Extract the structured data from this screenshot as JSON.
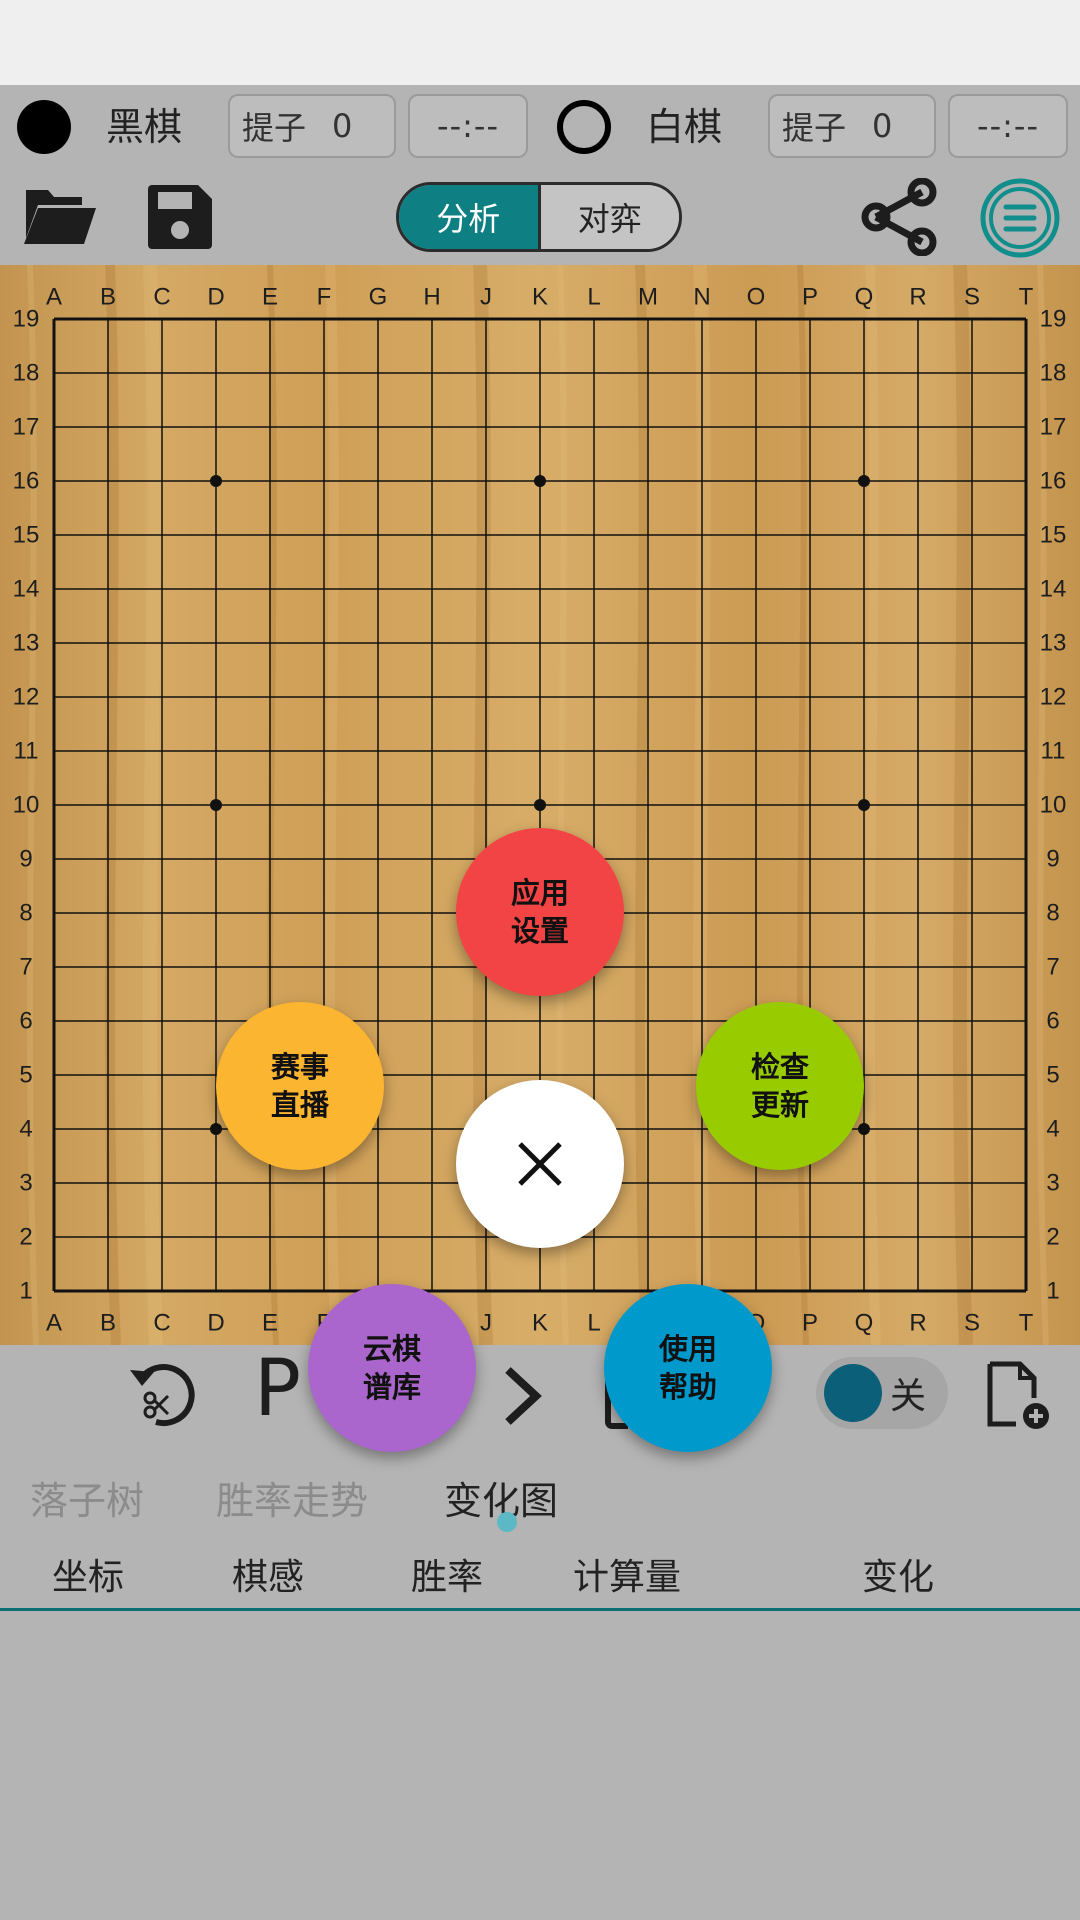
{
  "players": {
    "black": {
      "name": "黑棋",
      "captures_label": "提子",
      "captures": "0",
      "time": "--:--"
    },
    "white": {
      "name": "白棋",
      "captures_label": "提子",
      "captures": "0",
      "time": "--:--"
    }
  },
  "toolbar": {
    "mode_tabs": [
      "分析",
      "对弈"
    ],
    "active_mode": "分析"
  },
  "board": {
    "columns": [
      "A",
      "B",
      "C",
      "D",
      "E",
      "F",
      "G",
      "H",
      "J",
      "K",
      "L",
      "M",
      "N",
      "O",
      "P",
      "Q",
      "R",
      "S",
      "T"
    ],
    "rows": [
      "19",
      "18",
      "17",
      "16",
      "15",
      "14",
      "13",
      "12",
      "11",
      "10",
      "9",
      "8",
      "7",
      "6",
      "5",
      "4",
      "3",
      "2",
      "1"
    ],
    "size": 19
  },
  "fab_menu": {
    "settings": {
      "line1": "应用",
      "line2": "设置",
      "color": "#f24444"
    },
    "live": {
      "line1": "赛事",
      "line2": "直播",
      "color": "#fbb530"
    },
    "update": {
      "line1": "检查",
      "line2": "更新",
      "color": "#99cc00"
    },
    "cloud": {
      "line1": "云棋",
      "line2": "谱库",
      "color": "#aa66cc"
    },
    "help": {
      "line1": "使用",
      "line2": "帮助",
      "color": "#0099cc"
    },
    "close_icon": "close-icon"
  },
  "controls": {
    "pass_label": "P",
    "toggle_label": "关",
    "toggle_on": false
  },
  "tabs": {
    "items": [
      "落子树",
      "胜率走势",
      "变化图"
    ],
    "active_index": 2
  },
  "table": {
    "columns": [
      "坐标",
      "棋感",
      "胜率",
      "计算量",
      "变化"
    ]
  }
}
